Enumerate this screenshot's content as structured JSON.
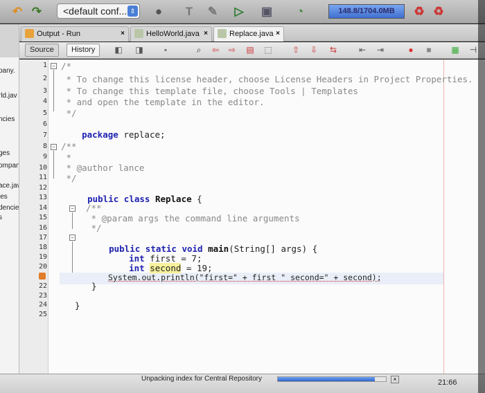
{
  "toolbar": {
    "config_value": "<default conf...",
    "memory_text": "148.8/1704.0MB",
    "icons": [
      "undo-icon",
      "redo-icon",
      "config-select",
      "settings-icon",
      "clean-build-icon",
      "broom-icon",
      "run-icon",
      "debug-icon",
      "profile-icon",
      "memory-indicator",
      "gc-icon",
      "gc2-icon"
    ]
  },
  "left_panel": {
    "items": [
      "pany.",
      "rld.jav",
      "ncies",
      "ges",
      "ompany.",
      "ace.java",
      "ies",
      "dencies",
      "s"
    ]
  },
  "tabs": [
    {
      "label": "Output - Run (Replace)",
      "close": "×"
    },
    {
      "label": "HelloWorld.java",
      "close": "×"
    },
    {
      "label": "Replace.java",
      "close": "×"
    }
  ],
  "editor_toolbar": {
    "source_label": "Source",
    "history_label": "History"
  },
  "lines": [
    "1",
    "2",
    "3",
    "4",
    "5",
    "6",
    "7",
    "8",
    "9",
    "10",
    "11",
    "12",
    "13",
    "14",
    "15",
    "16",
    "17",
    "18",
    "19",
    "20",
    "22",
    "23",
    "24",
    "25"
  ],
  "code": {
    "l1": "/*",
    "l2": " * To change this license header, choose License Headers in Project Properties.",
    "l3": " * To change this template file, choose Tools | Templates",
    "l4": " * and open the template in the editor.",
    "l5": " */",
    "l6_kw": "package",
    "l6_rest": " replace;",
    "l8": "/**",
    "l9": " *",
    "l10": " * @author lance",
    "l11": " */",
    "l12_kw": "public class",
    "l12_name": " Replace",
    "l12_rest": " {",
    "l14": "/**",
    "l15": " * @param args the command line arguments",
    "l16": " */",
    "l17_kw": "public static void",
    "l17_name": " main",
    "l17_rest": "(String[] args) {",
    "l18_kw": "int",
    "l18_rest": " first = 7;",
    "l19_kw": "int",
    "l19_var": "second",
    "l19_rest": " = 19;",
    "l21": "System.out.println(\"first=\" + first \" second=\" + second);",
    "l22": "}",
    "l24": "}"
  },
  "status": {
    "message": "Unpacking index for Central Repository",
    "progress": 0.9,
    "time": "21:66"
  }
}
